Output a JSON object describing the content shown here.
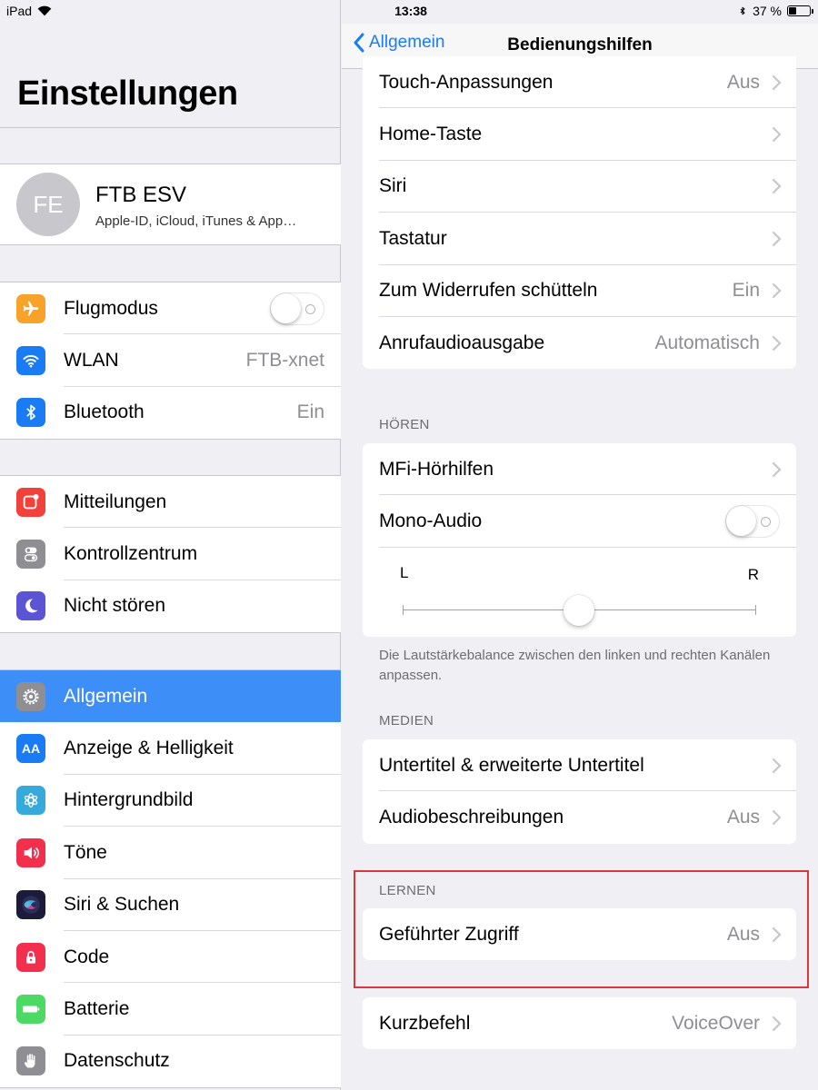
{
  "status_bar": {
    "device": "iPad",
    "time": "13:38",
    "battery": "37 %",
    "battery_level": 0.37
  },
  "sidebar": {
    "title": "Einstellungen",
    "profile": {
      "initials": "FE",
      "name": "FTB ESV",
      "subtitle": "Apple-ID, iCloud, iTunes & App…"
    },
    "group1": [
      {
        "label": "Flugmodus",
        "icon": "airplane-icon",
        "color": "#f7a229",
        "toggle": false
      },
      {
        "label": "WLAN",
        "icon": "wifi-icon",
        "color": "#1a7cf5",
        "value": "FTB-xnet"
      },
      {
        "label": "Bluetooth",
        "icon": "bluetooth-icon",
        "color": "#1a7cf5",
        "value": "Ein"
      }
    ],
    "group2": [
      {
        "label": "Mitteilungen",
        "icon": "notifications-icon",
        "color": "#f2413a"
      },
      {
        "label": "Kontrollzentrum",
        "icon": "control-center-icon",
        "color": "#8e8e93"
      },
      {
        "label": "Nicht stören",
        "icon": "moon-icon",
        "color": "#5b55d6"
      }
    ],
    "group3": [
      {
        "label": "Allgemein",
        "icon": "gear-icon",
        "color": "#8e8e93",
        "selected": true
      },
      {
        "label": "Anzeige & Helligkeit",
        "icon": "display-icon",
        "color": "#1a7cf5",
        "icon_text": "AA"
      },
      {
        "label": "Hintergrundbild",
        "icon": "wallpaper-icon",
        "color": "#37aadc"
      },
      {
        "label": "Töne",
        "icon": "speaker-icon",
        "color": "#f2304e"
      },
      {
        "label": "Siri & Suchen",
        "icon": "siri-icon",
        "color": "#1c1c3a"
      },
      {
        "label": "Code",
        "icon": "lock-icon",
        "color": "#f2304e"
      },
      {
        "label": "Batterie",
        "icon": "battery-icon",
        "color": "#4cd964"
      },
      {
        "label": "Datenschutz",
        "icon": "hand-icon",
        "color": "#8e8e93"
      }
    ]
  },
  "detail": {
    "back_label": "Allgemein",
    "title": "Bedienungshilfen",
    "top_rows": [
      {
        "label": "Touch-Anpassungen",
        "value": "Aus"
      },
      {
        "label": "Home-Taste",
        "value": ""
      },
      {
        "label": "Siri",
        "value": ""
      },
      {
        "label": "Tastatur",
        "value": ""
      },
      {
        "label": "Zum Widerrufen schütteln",
        "value": "Ein"
      },
      {
        "label": "Anrufaudioausgabe",
        "value": "Automatisch"
      }
    ],
    "hearing": {
      "header": "HÖREN",
      "mfi": "MFi-Hörhilfen",
      "mono": "Mono-Audio",
      "mono_on": false,
      "left_label": "L",
      "right_label": "R",
      "balance": 0.5,
      "footer": "Die Lautstärkebalance zwischen den linken und rechten Kanälen anpassen."
    },
    "media": {
      "header": "MEDIEN",
      "rows": [
        {
          "label": "Untertitel & erweiterte Untertitel",
          "value": ""
        },
        {
          "label": "Audiobeschreibungen",
          "value": "Aus"
        }
      ]
    },
    "learning": {
      "header": "LERNEN",
      "row": {
        "label": "Geführter Zugriff",
        "value": "Aus"
      }
    },
    "shortcut": {
      "label": "Kurzbefehl",
      "value": "VoiceOver"
    }
  },
  "colors": {
    "accent": "#1a7cf5",
    "selected_row": "#3d8ef7",
    "highlight": "#d8383d"
  }
}
